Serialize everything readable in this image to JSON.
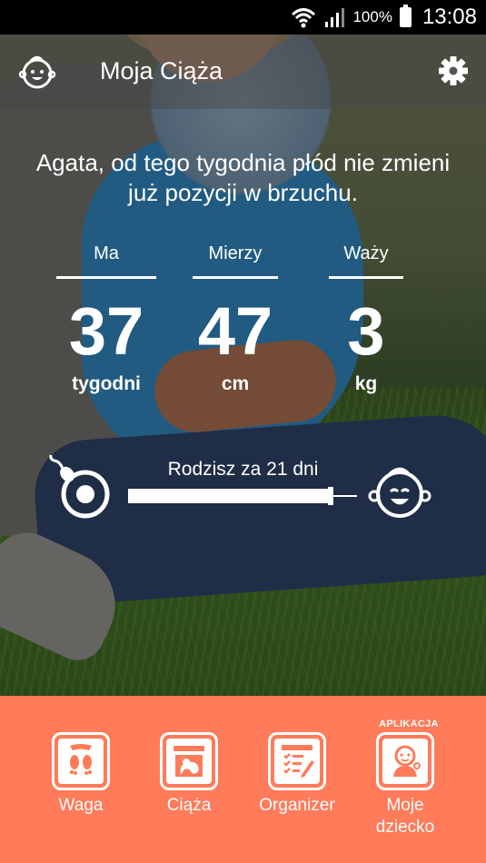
{
  "status_bar": {
    "battery": "100%",
    "time": "13:08"
  },
  "app_bar": {
    "title": "Moja Ciąża",
    "logo_icon": "baby-face-icon",
    "settings_icon": "gear-icon"
  },
  "headline": "Agata, od tego tygodnia płód nie zmieni już pozycji w brzuchu.",
  "stats": [
    {
      "label": "Ma",
      "value": "37",
      "unit": "tygodni"
    },
    {
      "label": "Mierzy",
      "value": "47",
      "unit": "cm"
    },
    {
      "label": "Waży",
      "value": "3",
      "unit": "kg"
    }
  ],
  "progress": {
    "label": "Rodzisz za 21 dni",
    "fraction": 0.92,
    "start_icon": "sperm-egg-icon",
    "end_icon": "baby-face-icon"
  },
  "nav": {
    "badge": "APLIKACJA",
    "items": [
      {
        "label": "Waga",
        "icon": "scale-feet-icon"
      },
      {
        "label": "Ciąża",
        "icon": "ultrasound-icon"
      },
      {
        "label": "Organizer",
        "icon": "checklist-icon"
      },
      {
        "label": "Moje dziecko",
        "icon": "baby-app-icon"
      }
    ]
  },
  "colors": {
    "accent": "#ff7b59",
    "text": "#ffffff"
  }
}
